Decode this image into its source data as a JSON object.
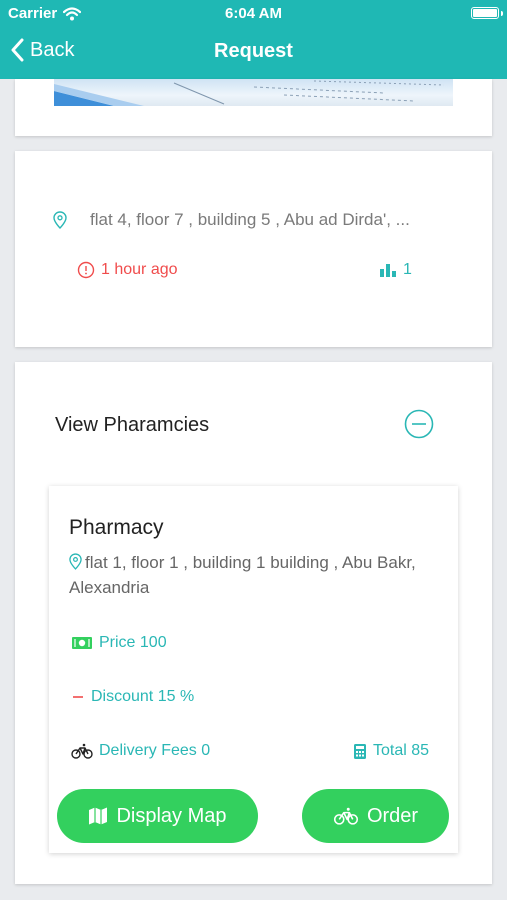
{
  "status_bar": {
    "carrier": "Carrier",
    "time": "6:04 AM"
  },
  "nav": {
    "back_label": "Back",
    "title": "Request"
  },
  "request": {
    "address": "flat 4, floor 7 , building 5 , Abu ad Dirda', ...",
    "time_ago": "1 hour ago",
    "count": "1"
  },
  "pharmacies": {
    "section_title": "View Pharamcies",
    "items": [
      {
        "name": "Pharmacy",
        "address": "flat 1, floor 1 , building 1 building , Abu Bakr, Alexandria",
        "price": "Price 100",
        "discount": "Discount 15 %",
        "delivery_fees": "Delivery Fees 0",
        "total": "Total 85",
        "display_map_label": "Display Map",
        "order_label": "Order"
      }
    ]
  },
  "colors": {
    "header_bg": "#1fb8b4",
    "accent_teal": "#2ab7b5",
    "button_green": "#33d05e",
    "alert_red": "#f04c4c",
    "money_green": "#33d05e"
  }
}
